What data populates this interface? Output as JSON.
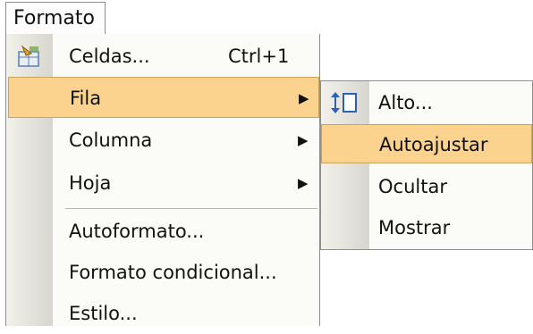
{
  "menubar": {
    "formato_label": "Formato"
  },
  "menu": {
    "items": [
      {
        "label": "Celdas...",
        "shortcut": "Ctrl+1",
        "icon": "format-cells-icon"
      },
      {
        "label": "Fila",
        "arrow": "▶"
      },
      {
        "label": "Columna",
        "arrow": "▶"
      },
      {
        "label": "Hoja",
        "arrow": "▶"
      },
      {
        "label": "Autoformato..."
      },
      {
        "label": "Formato condicional..."
      },
      {
        "label": "Estilo..."
      }
    ]
  },
  "submenu": {
    "items": [
      {
        "label": "Alto...",
        "icon": "row-height-icon"
      },
      {
        "label": "Autoajustar"
      },
      {
        "label": "Ocultar"
      },
      {
        "label": "Mostrar"
      }
    ]
  },
  "colors": {
    "highlight": "#fbd38f",
    "highlight_border": "#c9a55c",
    "menu_bg": "#fbfbf7"
  }
}
